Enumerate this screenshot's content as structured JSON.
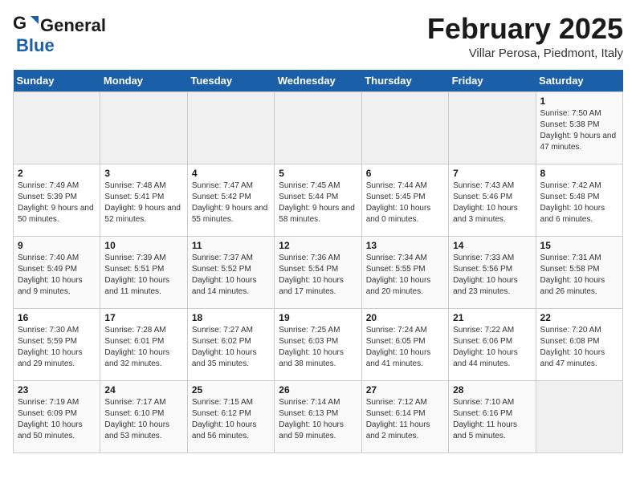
{
  "logo": {
    "general": "General",
    "blue": "Blue"
  },
  "title": "February 2025",
  "subtitle": "Villar Perosa, Piedmont, Italy",
  "headers": [
    "Sunday",
    "Monday",
    "Tuesday",
    "Wednesday",
    "Thursday",
    "Friday",
    "Saturday"
  ],
  "weeks": [
    [
      {
        "num": "",
        "info": ""
      },
      {
        "num": "",
        "info": ""
      },
      {
        "num": "",
        "info": ""
      },
      {
        "num": "",
        "info": ""
      },
      {
        "num": "",
        "info": ""
      },
      {
        "num": "",
        "info": ""
      },
      {
        "num": "1",
        "info": "Sunrise: 7:50 AM\nSunset: 5:38 PM\nDaylight: 9 hours and 47 minutes."
      }
    ],
    [
      {
        "num": "2",
        "info": "Sunrise: 7:49 AM\nSunset: 5:39 PM\nDaylight: 9 hours and 50 minutes."
      },
      {
        "num": "3",
        "info": "Sunrise: 7:48 AM\nSunset: 5:41 PM\nDaylight: 9 hours and 52 minutes."
      },
      {
        "num": "4",
        "info": "Sunrise: 7:47 AM\nSunset: 5:42 PM\nDaylight: 9 hours and 55 minutes."
      },
      {
        "num": "5",
        "info": "Sunrise: 7:45 AM\nSunset: 5:44 PM\nDaylight: 9 hours and 58 minutes."
      },
      {
        "num": "6",
        "info": "Sunrise: 7:44 AM\nSunset: 5:45 PM\nDaylight: 10 hours and 0 minutes."
      },
      {
        "num": "7",
        "info": "Sunrise: 7:43 AM\nSunset: 5:46 PM\nDaylight: 10 hours and 3 minutes."
      },
      {
        "num": "8",
        "info": "Sunrise: 7:42 AM\nSunset: 5:48 PM\nDaylight: 10 hours and 6 minutes."
      }
    ],
    [
      {
        "num": "9",
        "info": "Sunrise: 7:40 AM\nSunset: 5:49 PM\nDaylight: 10 hours and 9 minutes."
      },
      {
        "num": "10",
        "info": "Sunrise: 7:39 AM\nSunset: 5:51 PM\nDaylight: 10 hours and 11 minutes."
      },
      {
        "num": "11",
        "info": "Sunrise: 7:37 AM\nSunset: 5:52 PM\nDaylight: 10 hours and 14 minutes."
      },
      {
        "num": "12",
        "info": "Sunrise: 7:36 AM\nSunset: 5:54 PM\nDaylight: 10 hours and 17 minutes."
      },
      {
        "num": "13",
        "info": "Sunrise: 7:34 AM\nSunset: 5:55 PM\nDaylight: 10 hours and 20 minutes."
      },
      {
        "num": "14",
        "info": "Sunrise: 7:33 AM\nSunset: 5:56 PM\nDaylight: 10 hours and 23 minutes."
      },
      {
        "num": "15",
        "info": "Sunrise: 7:31 AM\nSunset: 5:58 PM\nDaylight: 10 hours and 26 minutes."
      }
    ],
    [
      {
        "num": "16",
        "info": "Sunrise: 7:30 AM\nSunset: 5:59 PM\nDaylight: 10 hours and 29 minutes."
      },
      {
        "num": "17",
        "info": "Sunrise: 7:28 AM\nSunset: 6:01 PM\nDaylight: 10 hours and 32 minutes."
      },
      {
        "num": "18",
        "info": "Sunrise: 7:27 AM\nSunset: 6:02 PM\nDaylight: 10 hours and 35 minutes."
      },
      {
        "num": "19",
        "info": "Sunrise: 7:25 AM\nSunset: 6:03 PM\nDaylight: 10 hours and 38 minutes."
      },
      {
        "num": "20",
        "info": "Sunrise: 7:24 AM\nSunset: 6:05 PM\nDaylight: 10 hours and 41 minutes."
      },
      {
        "num": "21",
        "info": "Sunrise: 7:22 AM\nSunset: 6:06 PM\nDaylight: 10 hours and 44 minutes."
      },
      {
        "num": "22",
        "info": "Sunrise: 7:20 AM\nSunset: 6:08 PM\nDaylight: 10 hours and 47 minutes."
      }
    ],
    [
      {
        "num": "23",
        "info": "Sunrise: 7:19 AM\nSunset: 6:09 PM\nDaylight: 10 hours and 50 minutes."
      },
      {
        "num": "24",
        "info": "Sunrise: 7:17 AM\nSunset: 6:10 PM\nDaylight: 10 hours and 53 minutes."
      },
      {
        "num": "25",
        "info": "Sunrise: 7:15 AM\nSunset: 6:12 PM\nDaylight: 10 hours and 56 minutes."
      },
      {
        "num": "26",
        "info": "Sunrise: 7:14 AM\nSunset: 6:13 PM\nDaylight: 10 hours and 59 minutes."
      },
      {
        "num": "27",
        "info": "Sunrise: 7:12 AM\nSunset: 6:14 PM\nDaylight: 11 hours and 2 minutes."
      },
      {
        "num": "28",
        "info": "Sunrise: 7:10 AM\nSunset: 6:16 PM\nDaylight: 11 hours and 5 minutes."
      },
      {
        "num": "",
        "info": ""
      }
    ]
  ]
}
